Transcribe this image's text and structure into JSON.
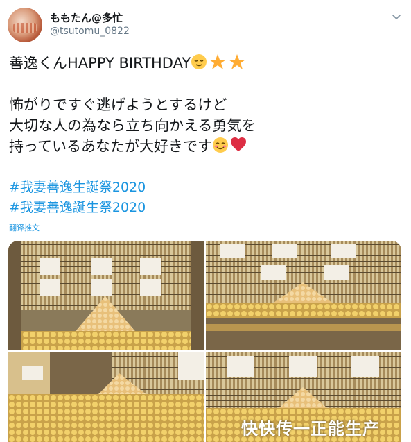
{
  "user": {
    "display_name": "ももたん@多忙",
    "handle": "@tsutomu_0822"
  },
  "tweet": {
    "line1": "善逸くんHAPPY BIRTHDAY",
    "line3": "怖がりですぐ逃げようとするけど",
    "line4": "大切な人の為なら立ち向かえる勇気を",
    "line5": "持っているあなたが大好きです",
    "hashtag1": "#我妻善逸生誕祭2020",
    "hashtag2": "#我妻善逸誕生祭2020",
    "translate_label": "翻译推文"
  },
  "icons": [
    "chevron-down-icon",
    "relieved-face-emoji",
    "star-emoji",
    "smiling-face-emoji",
    "red-heart-emoji"
  ],
  "colors": {
    "link": "#1b95e0",
    "text": "#14171a",
    "secondary": "#657786"
  },
  "media": {
    "photo_count": 4
  },
  "watermark": {
    "text": "快快传一正能生产"
  }
}
